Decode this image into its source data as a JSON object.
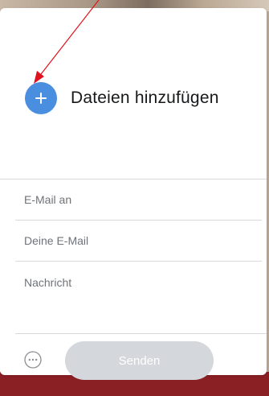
{
  "transfer_form": {
    "add_files_label": "Dateien hinzufügen",
    "email_to_placeholder": "E-Mail an",
    "email_from_placeholder": "Deine E-Mail",
    "message_placeholder": "Nachricht",
    "send_label": "Senden",
    "options_icon": "more-options-icon",
    "add_icon": "plus-icon"
  },
  "colors": {
    "accent": "#4a8fdf",
    "send_disabled": "#d4d7db",
    "annotation_arrow": "#e0141e"
  }
}
